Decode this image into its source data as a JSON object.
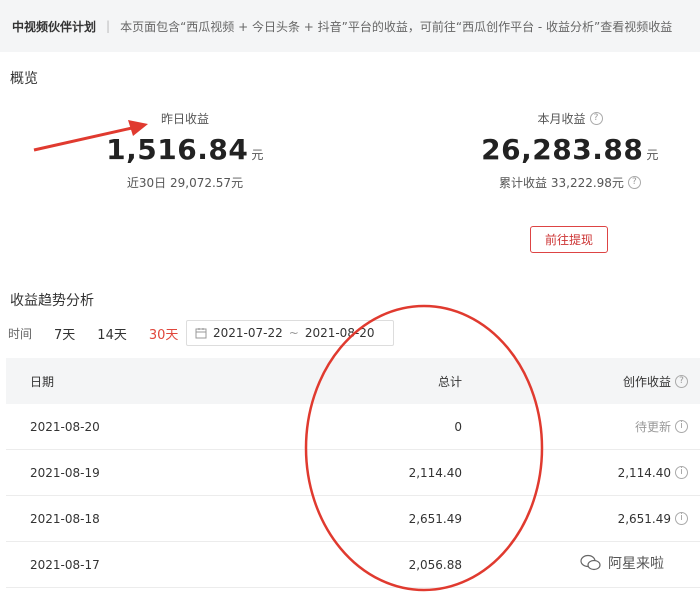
{
  "topbar": {
    "brand": "中视频伙伴计划",
    "separator": "|",
    "description": "本页面包含“西瓜视频 + 今日头条 + 抖音”平台的收益，可前往“西瓜创作平台 - 收益分析”查看视频收益"
  },
  "overview": {
    "title": "概览",
    "yesterday": {
      "label": "昨日收益",
      "value": "1,516.84",
      "unit": "元",
      "sub": "近30日 29,072.57元"
    },
    "month": {
      "label": "本月收益",
      "value": "26,283.88",
      "unit": "元",
      "sub": "累计收益 33,222.98元"
    },
    "withdraw_label": "前往提现"
  },
  "trend": {
    "title": "收益趋势分析",
    "time_label": "时间",
    "ranges": [
      "7天",
      "14天",
      "30天"
    ],
    "active_range": "30天",
    "date_start": "2021-07-22",
    "date_sep": "~",
    "date_end": "2021-08-20"
  },
  "table": {
    "headers": {
      "date": "日期",
      "total": "总计",
      "creation": "创作收益"
    },
    "rows": [
      {
        "date": "2021-08-20",
        "total": "0",
        "creation": "待更新"
      },
      {
        "date": "2021-08-19",
        "total": "2,114.40",
        "creation": "2,114.40"
      },
      {
        "date": "2021-08-18",
        "total": "2,651.49",
        "creation": "2,651.49"
      },
      {
        "date": "2021-08-17",
        "total": "2,056.88",
        "creation": ""
      }
    ]
  },
  "watermark": {
    "text": "阿星来啦",
    "icon": "wechat-icon"
  },
  "colors": {
    "accent": "#e0473c",
    "annotation": "#e03a2f",
    "header_bg": "#f4f5f6"
  }
}
